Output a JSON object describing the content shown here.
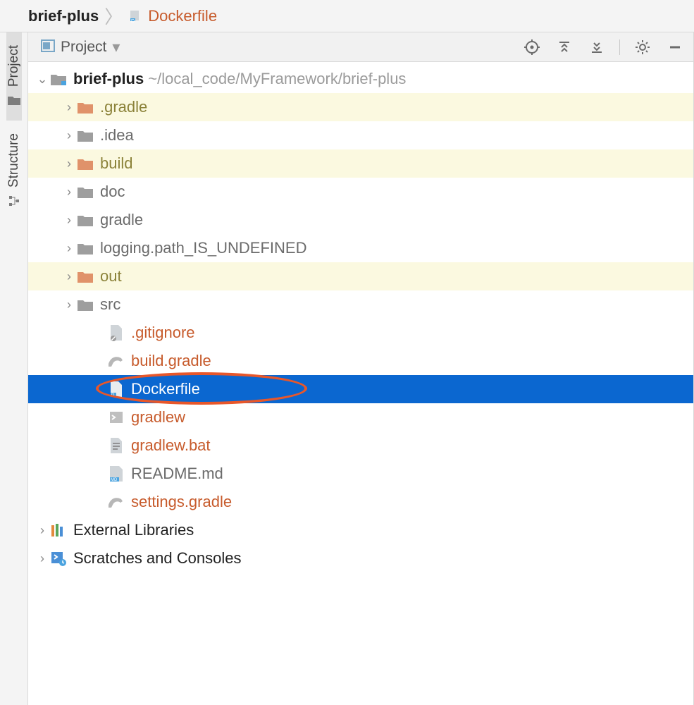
{
  "breadcrumb": {
    "root": "brief-plus",
    "file": "Dockerfile"
  },
  "gutter": {
    "project": "Project",
    "structure": "Structure"
  },
  "panel": {
    "title": "Project"
  },
  "tree": {
    "root_name": "brief-plus",
    "root_path": "~/local_code/MyFramework/brief-plus",
    "items": [
      {
        "name": ".gradle",
        "type": "folder",
        "color": "olive",
        "highlight": true,
        "expandable": true
      },
      {
        "name": ".idea",
        "type": "folder",
        "color": "gray",
        "expandable": true
      },
      {
        "name": "build",
        "type": "folder",
        "color": "olive",
        "highlight": true,
        "expandable": true
      },
      {
        "name": "doc",
        "type": "folder",
        "color": "gray",
        "expandable": true
      },
      {
        "name": "gradle",
        "type": "folder",
        "color": "gray",
        "expandable": true
      },
      {
        "name": "logging.path_IS_UNDEFINED",
        "type": "folder",
        "color": "gray",
        "expandable": true
      },
      {
        "name": "out",
        "type": "folder",
        "color": "olive",
        "highlight": true,
        "expandable": true
      },
      {
        "name": "src",
        "type": "folder",
        "color": "gray",
        "expandable": true
      },
      {
        "name": ".gitignore",
        "type": "file",
        "icon": "gitignore",
        "color": "orange"
      },
      {
        "name": "build.gradle",
        "type": "file",
        "icon": "gradle",
        "color": "orange"
      },
      {
        "name": "Dockerfile",
        "type": "file",
        "icon": "docker",
        "color": "orange",
        "selected": true,
        "circled": true
      },
      {
        "name": "gradlew",
        "type": "file",
        "icon": "shell",
        "color": "orange"
      },
      {
        "name": "gradlew.bat",
        "type": "file",
        "icon": "text",
        "color": "orange"
      },
      {
        "name": "README.md",
        "type": "file",
        "icon": "md",
        "color": "gray"
      },
      {
        "name": "settings.gradle",
        "type": "file",
        "icon": "gradle",
        "color": "orange"
      }
    ],
    "external_libs": "External Libraries",
    "scratches": "Scratches and Consoles"
  }
}
